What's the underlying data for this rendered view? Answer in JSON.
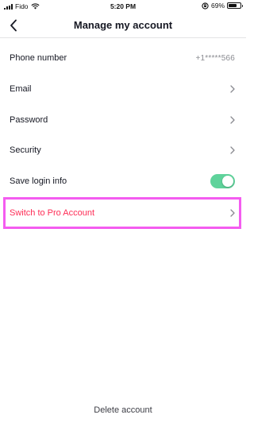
{
  "status_bar": {
    "carrier": "Fido",
    "time": "5:20 PM",
    "battery_percent": "69%",
    "battery_level": 0.69,
    "icons": [
      "signal-icon",
      "wifi-icon",
      "orientation-lock-icon",
      "battery-icon"
    ]
  },
  "nav": {
    "title": "Manage my account",
    "back_icon": "chevron-left-icon"
  },
  "rows": {
    "phone": {
      "label": "Phone number",
      "value": "+1*****566"
    },
    "email": {
      "label": "Email"
    },
    "password": {
      "label": "Password"
    },
    "security": {
      "label": "Security"
    },
    "save_login": {
      "label": "Save login info",
      "enabled": true
    },
    "pro_account": {
      "label": "Switch to Pro Account"
    }
  },
  "footer": {
    "delete_label": "Delete account"
  },
  "colors": {
    "accent_pink": "#fe2c55",
    "toggle_on": "#5fd39b",
    "highlight": "#f45cf0",
    "text_primary": "#161823",
    "text_secondary": "#8a8b91"
  }
}
